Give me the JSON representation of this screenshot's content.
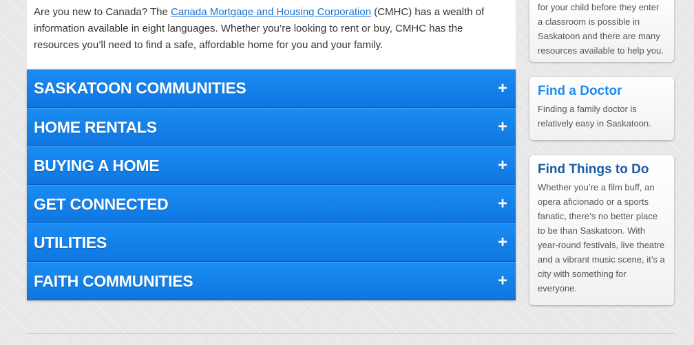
{
  "intro": {
    "text_before": "Are you new to Canada? The ",
    "link_text": "Canada Mortgage and Housing Corporation",
    "text_after": " (CMHC) has a wealth of information available in eight languages. Whether you’re looking to rent or buy, CMHC has the resources you’ll need to find a safe, affordable home for you and your family."
  },
  "accordion": {
    "items": [
      {
        "label": "SASKATOON COMMUNITIES",
        "icon": "+"
      },
      {
        "label": "HOME RENTALS",
        "icon": "+"
      },
      {
        "label": "BUYING A HOME",
        "icon": "+"
      },
      {
        "label": "GET CONNECTED",
        "icon": "+"
      },
      {
        "label": "UTILITIES",
        "icon": "+"
      },
      {
        "label": "FAITH COMMUNITIES",
        "icon": "+"
      }
    ]
  },
  "sidebar": {
    "cards": [
      {
        "title": "",
        "text": "for your child before they enter a classroom is possible in Saskatoon and there are many resources available to help you.",
        "color": "#333333"
      },
      {
        "title": "Find a Doctor",
        "text": "Finding a family doctor is relatively easy in Saskatoon.",
        "color": "#1a8cf2"
      },
      {
        "title": "Find Things to Do",
        "text": "Whether you’re a film buff, an opera aficionado or a sports fanatic, there’s no better place to be than Saskatoon. With year-round festivals, live theatre and a vibrant music scene, it’s a city with something for everyone.",
        "color": "#1b5aa6"
      }
    ]
  },
  "colors": {
    "accent_blue": "#1a8cf2",
    "link_blue": "#1a6fd4",
    "dark_blue": "#1b5aa6"
  }
}
